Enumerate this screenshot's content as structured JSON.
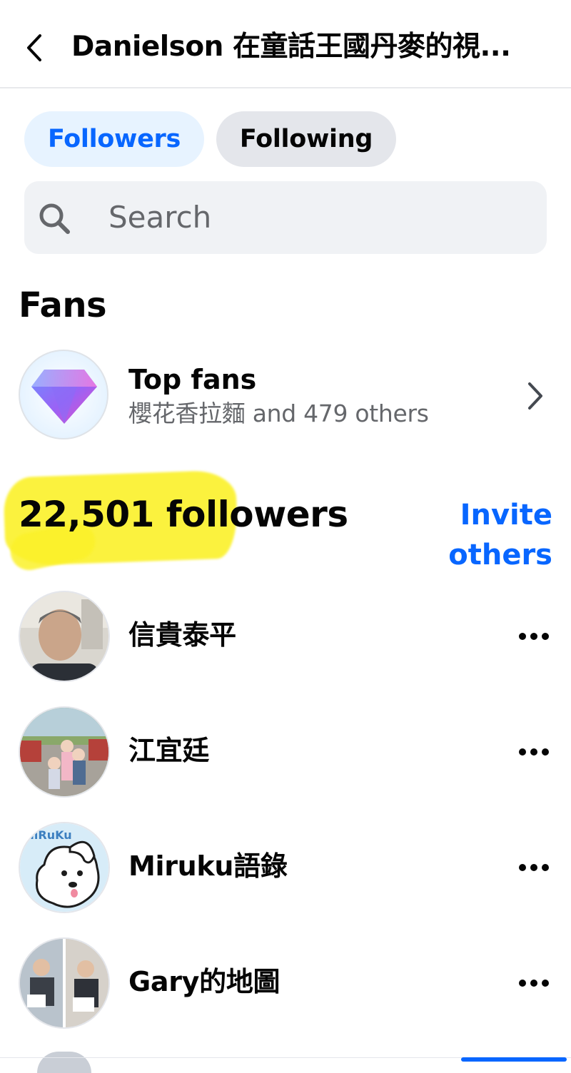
{
  "header": {
    "back_icon": "chevron-left-icon",
    "title": "Danielson 在童話王國丹麥的視..."
  },
  "tabs": [
    {
      "label": "Followers",
      "active": true
    },
    {
      "label": "Following",
      "active": false
    }
  ],
  "search": {
    "icon": "search-icon",
    "placeholder": "Search"
  },
  "fans": {
    "section_title": "Fans",
    "top_fans": {
      "icon": "diamond-icon",
      "label": "Top fans",
      "subtitle": "櫻花香拉麵 and 479 others",
      "chevron": "chevron-right-icon"
    }
  },
  "followers": {
    "count_label": "22,501 followers",
    "invite_label": "Invite others",
    "highlight_color": "#fbf12a",
    "items": [
      {
        "name": "信貴泰平",
        "more_icon": "more-icon"
      },
      {
        "name": "江宜廷",
        "more_icon": "more-icon"
      },
      {
        "name": "Miruku語錄",
        "more_icon": "more-icon"
      },
      {
        "name": "Gary的地圖",
        "more_icon": "more-icon"
      }
    ]
  },
  "colors": {
    "accent": "#0866ff",
    "secondary_text": "#65676b",
    "chip_active_bg": "#e7f3ff",
    "chip_inactive_bg": "#e4e6eb"
  }
}
